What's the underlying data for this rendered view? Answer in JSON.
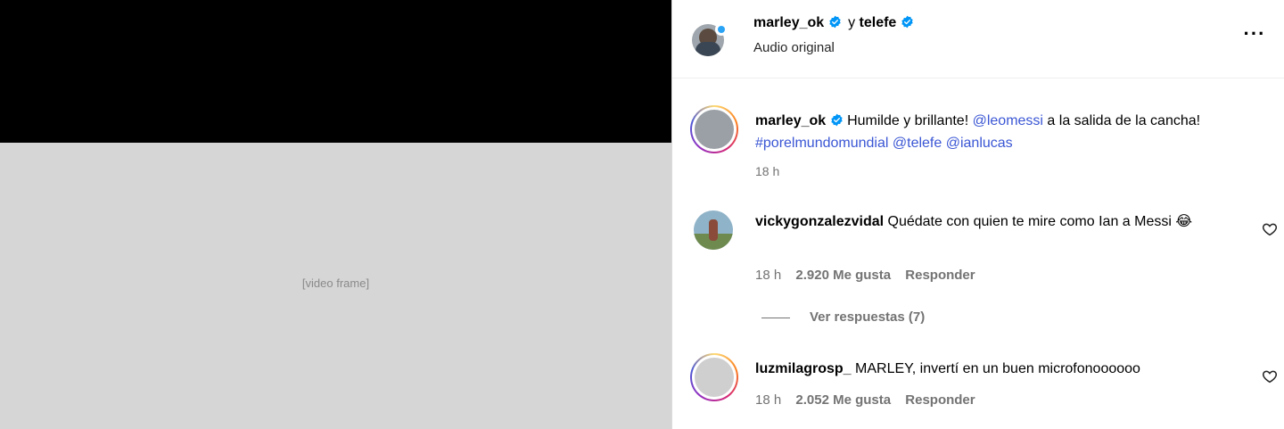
{
  "header": {
    "username": "marley_ok",
    "joiner": "y",
    "collaborator": "telefe",
    "subtitle": "Audio original",
    "more_icon": "more-horizontal-icon"
  },
  "caption": {
    "username": "marley_ok",
    "text_part1": "Humilde y brillante!",
    "mention1": "@leomessi",
    "text_part2": "a la salida de la cancha!",
    "hashtag": "#porelmundomundial",
    "mention2": "@telefe",
    "mention3": "@ianlucas",
    "time": "18 h"
  },
  "comments": [
    {
      "username": "vickygonzalezvidal",
      "text": "Quédate con quien te mire como Ian a Messi",
      "emoji": "😂",
      "time": "18 h",
      "likes": "2.920 Me gusta",
      "reply_label": "Responder",
      "view_replies": "Ver respuestas (7)"
    },
    {
      "username": "luzmilagrosp_",
      "text": "MARLEY, invertí en un buen microfonoooooo",
      "time": "18 h",
      "likes": "2.052 Me gusta",
      "reply_label": "Responder"
    }
  ],
  "icons": {
    "verified": "verified-badge-icon",
    "heart": "heart-outline-icon"
  },
  "colors": {
    "verified_blue": "#0095f6",
    "link_blue": "#3a56d4",
    "muted": "#737373"
  }
}
